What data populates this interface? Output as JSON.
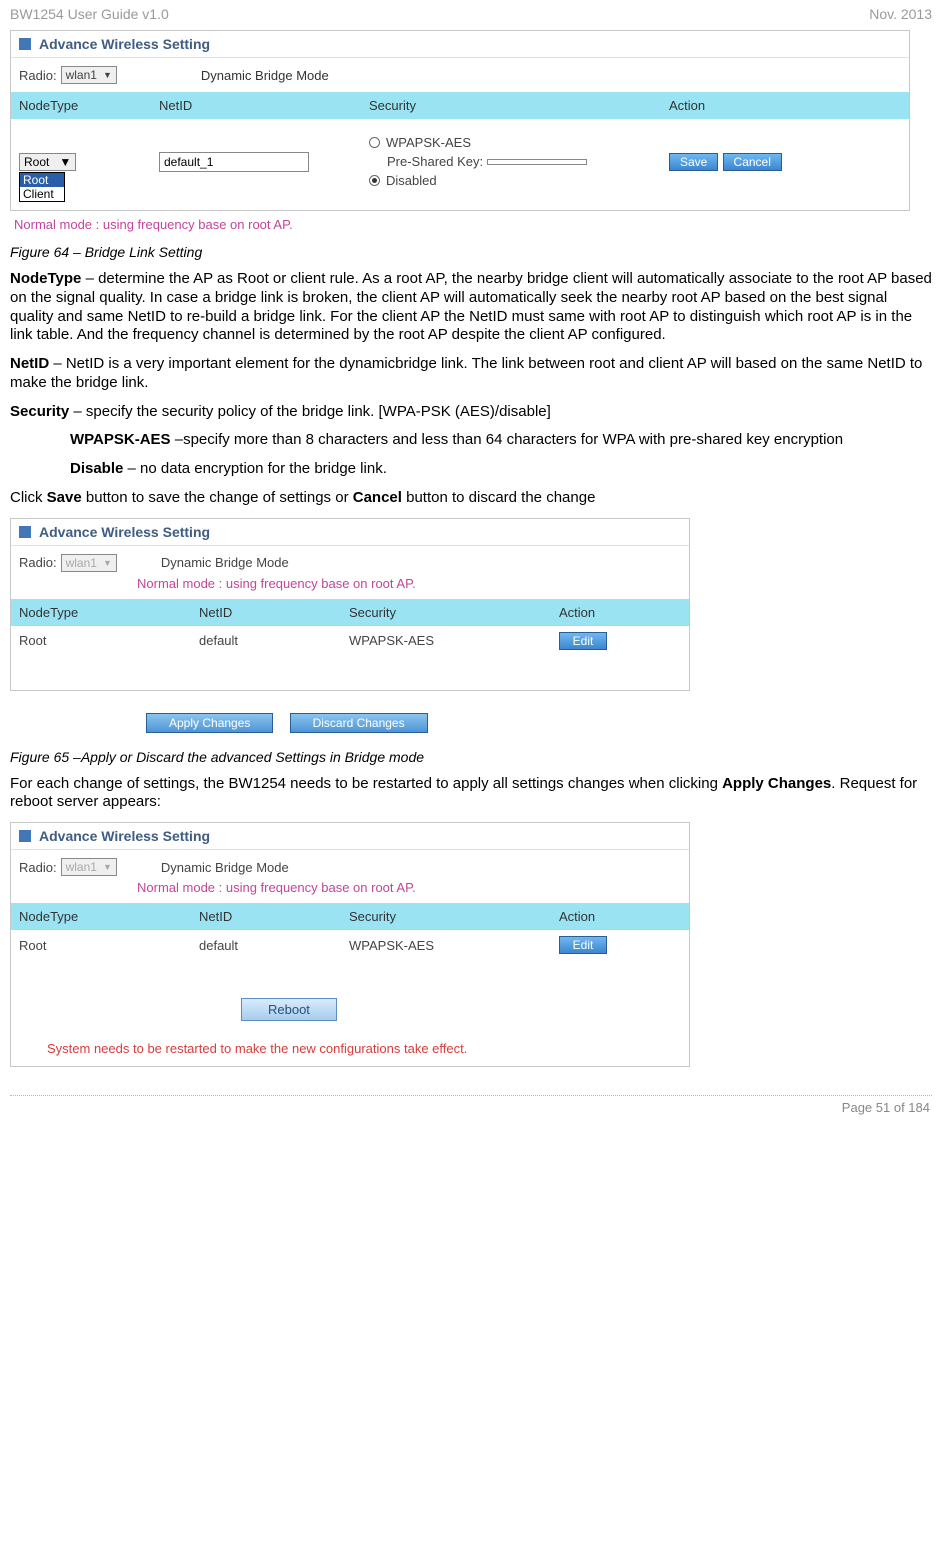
{
  "header": {
    "left": "BW1254 User Guide v1.0",
    "right": "Nov.  2013"
  },
  "panel1": {
    "title": "Advance Wireless  Setting",
    "radio_label": "Radio:",
    "radio_value": "wlan1",
    "mode_label": "Dynamic Bridge Mode",
    "cols": {
      "c1": "NodeType",
      "c2": "NetID",
      "c3": "Security",
      "c4": "Action"
    },
    "nodetype": "Root",
    "nodetype_opts": {
      "o1": "Root",
      "o2": "Client"
    },
    "netid": "default_1",
    "sec_opt1": "WPAPSK-AES",
    "psk_label": "Pre-Shared Key:",
    "psk_value": "",
    "sec_opt2": "Disabled",
    "save": "Save",
    "cancel": "Cancel",
    "note": "Normal mode : using frequency base on root AP."
  },
  "fig64": "Figure 64 – Bridge Link Setting",
  "para": {
    "nodetype_b": "NodeType",
    "nodetype_t": " – determine the AP as Root or client rule. As a root AP, the nearby bridge client will automatically associate to the root AP based on the signal quality. In case a bridge link is broken, the client AP will automatically seek the nearby root AP based on the best signal quality and same NetID to re-build a bridge link. For the client AP the NetID must same with root AP to distinguish which root AP is in the link table. And the frequency channel is determined by the root AP despite the client AP configured.",
    "netid_b": "NetID",
    "netid_t": " – NetID is a very important element for the dynamicbridge link. The link between root and client AP will based on the same NetID to make the bridge link.",
    "sec_b": "Security",
    "sec_t": " – specify the security policy of the bridge link. [WPA-PSK (AES)/disable]",
    "wpa_b": "WPAPSK-AES",
    "wpa_t": " –specify more than 8 characters and less than 64 characters for WPA with pre-shared key encryption",
    "dis_b": "Disable",
    "dis_t": " – no data encryption for the bridge link.",
    "click1": "Click ",
    "save_b": "Save",
    "click2": " button to save the change of settings or ",
    "cancel_b": "Cancel",
    "click3": " button to discard the change"
  },
  "panel2": {
    "title": "Advance Wireless  Setting",
    "radio_label": "Radio:",
    "radio_value": "wlan1",
    "mode_label": "Dynamic Bridge Mode",
    "note": "Normal mode : using frequency base on root AP.",
    "cols": {
      "c1": "NodeType",
      "c2": "NetID",
      "c3": "Security",
      "c4": "Action"
    },
    "nodetype": "Root",
    "netid": "default",
    "security": "WPAPSK-AES",
    "edit": "Edit",
    "apply": "Apply Changes",
    "discard": "Discard Changes"
  },
  "fig65": "Figure 65 –Apply or Discard the advanced Settings in Bridge mode",
  "para2": {
    "t1": "For each change of settings, the BW1254 needs to be restarted to apply all settings changes when clicking ",
    "b1": "Apply Changes",
    "t2": ". Request for reboot server appears:"
  },
  "panel3": {
    "title": "Advance Wireless  Setting",
    "radio_label": "Radio:",
    "radio_value": "wlan1",
    "mode_label": "Dynamic Bridge Mode",
    "note": "Normal mode : using frequency base on root AP.",
    "cols": {
      "c1": "NodeType",
      "c2": "NetID",
      "c3": "Security",
      "c4": "Action"
    },
    "nodetype": "Root",
    "netid": "default",
    "security": "WPAPSK-AES",
    "edit": "Edit",
    "reboot": "Reboot",
    "restart_note": "System needs to be restarted to make the new configurations take effect."
  },
  "footer": "Page 51 of 184"
}
